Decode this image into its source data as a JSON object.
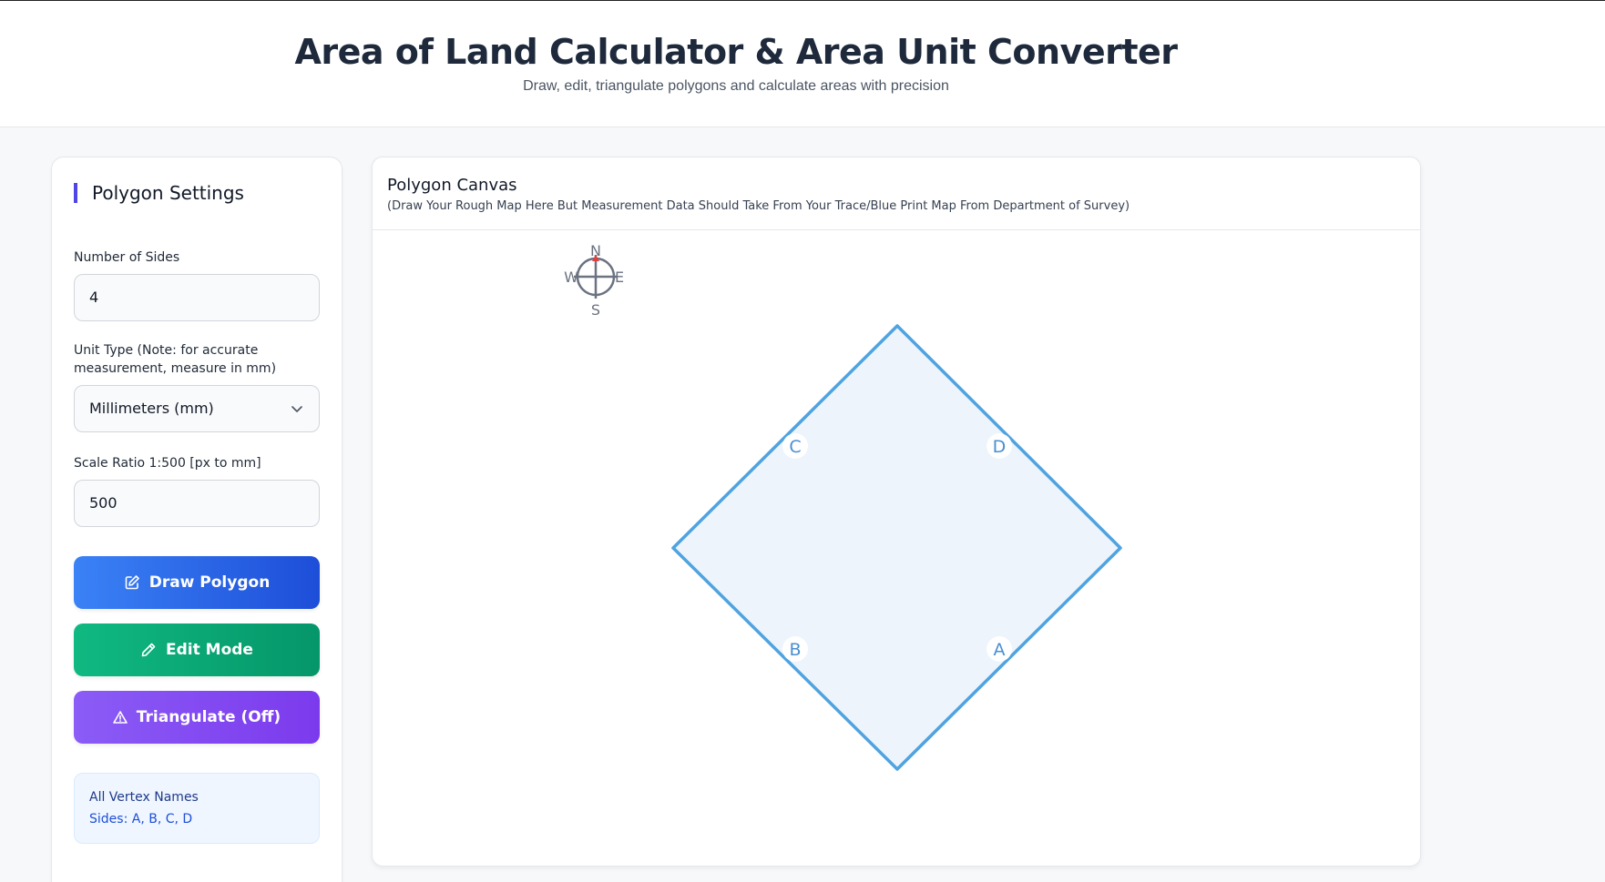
{
  "header": {
    "title": "Area of Land Calculator & Area Unit Converter",
    "subtitle": "Draw, edit, triangulate polygons and calculate areas with precision"
  },
  "settings": {
    "title": "Polygon Settings",
    "sides_label": "Number of Sides",
    "sides_value": "4",
    "unit_label": "Unit Type (Note: for accurate measurement, measure in mm)",
    "unit_value": "Millimeters (mm)",
    "scale_label": "Scale Ratio 1:500 [px to mm]",
    "scale_value": "500",
    "draw_label": "Draw Polygon",
    "edit_label": "Edit Mode",
    "triangulate_label": "Triangulate (Off)",
    "vertex_title": "All Vertex Names",
    "vertex_text": "Sides: A, B, C, D"
  },
  "canvas": {
    "title": "Polygon Canvas",
    "subtitle": "(Draw Your Rough Map Here But Measurement Data Should Take From Your Trace/Blue Print Map From Department of Survey)",
    "compass": {
      "n": "N",
      "s": "S",
      "e": "E",
      "w": "W"
    },
    "vertices": [
      "A",
      "B",
      "C",
      "D"
    ]
  },
  "colors": {
    "polygon_stroke": "#4fa3e0",
    "polygon_fill": "#edf4fb",
    "draw_button": "#2563eb",
    "edit_button": "#10b981",
    "triangulate_button": "#8b5cf6"
  }
}
